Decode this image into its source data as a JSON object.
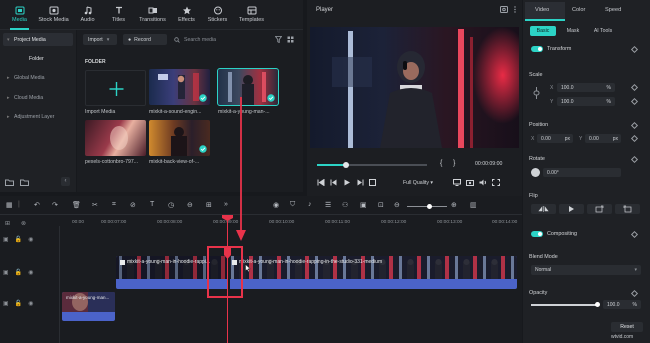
{
  "top_nav": {
    "tabs": [
      {
        "label": "Media",
        "icon": "media-icon",
        "active": true
      },
      {
        "label": "Stock Media",
        "icon": "stock-media-icon"
      },
      {
        "label": "Audio",
        "icon": "audio-icon"
      },
      {
        "label": "Titles",
        "icon": "titles-icon"
      },
      {
        "label": "Transitions",
        "icon": "transitions-icon"
      },
      {
        "label": "Effects",
        "icon": "effects-icon"
      },
      {
        "label": "Stickers",
        "icon": "stickers-icon"
      },
      {
        "label": "Templates",
        "icon": "templates-icon"
      }
    ]
  },
  "sidebar": {
    "items": [
      {
        "label": "Project Media",
        "active": true
      },
      {
        "label": "Folder"
      },
      {
        "label": "Global Media"
      },
      {
        "label": "Cloud Media"
      },
      {
        "label": "Adjustment Layer"
      }
    ]
  },
  "media": {
    "import_label": "Import",
    "record_label": "Record",
    "search_placeholder": "Search media",
    "folder_label": "FOLDER",
    "items": [
      {
        "label": "Import Media"
      },
      {
        "label": "mixkit-a-sound-engin..."
      },
      {
        "label": "mixkit-a-young-man-..."
      },
      {
        "label": "pexels-cottonbro-797..."
      },
      {
        "label": "mixkit-back-view-of-..."
      }
    ]
  },
  "player": {
    "title": "Player",
    "current_time": "00:00:09:00",
    "quality": "Full Quality",
    "progress": 0.26
  },
  "right_panel": {
    "tabs": [
      "Video",
      "Color",
      "Speed"
    ],
    "subtabs": [
      "Basic",
      "Mask",
      "AI Tools"
    ],
    "transform_label": "Transform",
    "scale_label": "Scale",
    "scale_x": "100.0",
    "scale_y": "100.0",
    "percent": "%",
    "position_label": "Position",
    "pos_x": "0.00",
    "pos_y": "0.00",
    "px": "px",
    "x_label": "X",
    "y_label": "Y",
    "rotate_label": "Rotate",
    "rotate_value": "0.00°",
    "flip_label": "Flip",
    "compositing_label": "Compositing",
    "blend_mode_label": "Blend Mode",
    "blend_mode_value": "Normal",
    "opacity_label": "Opacity",
    "opacity_value": "100.0",
    "reset_label": "Reset",
    "watermark": "wtvid.com"
  },
  "timeline": {
    "ruler": [
      "00:00",
      "00:00:07:00",
      "00:00:08:00",
      "00:00:09:00",
      "00:00:10:00",
      "00:00:11:00",
      "00:00:12:00",
      "00:00:13:00",
      "00:00:14:00"
    ],
    "clip1_title": "mixkit-a-young-man-in-hoodie-rappi...",
    "clip2_title": "mixkit-a-young-man-in-hoodie-rapping-in-the-studio-331-medium",
    "clip3_title": "mixkit-a-young-man..."
  },
  "colors": {
    "accent": "#2cd3c6",
    "clip_blue": "#4b63c9",
    "playhead": "#e8334a"
  }
}
